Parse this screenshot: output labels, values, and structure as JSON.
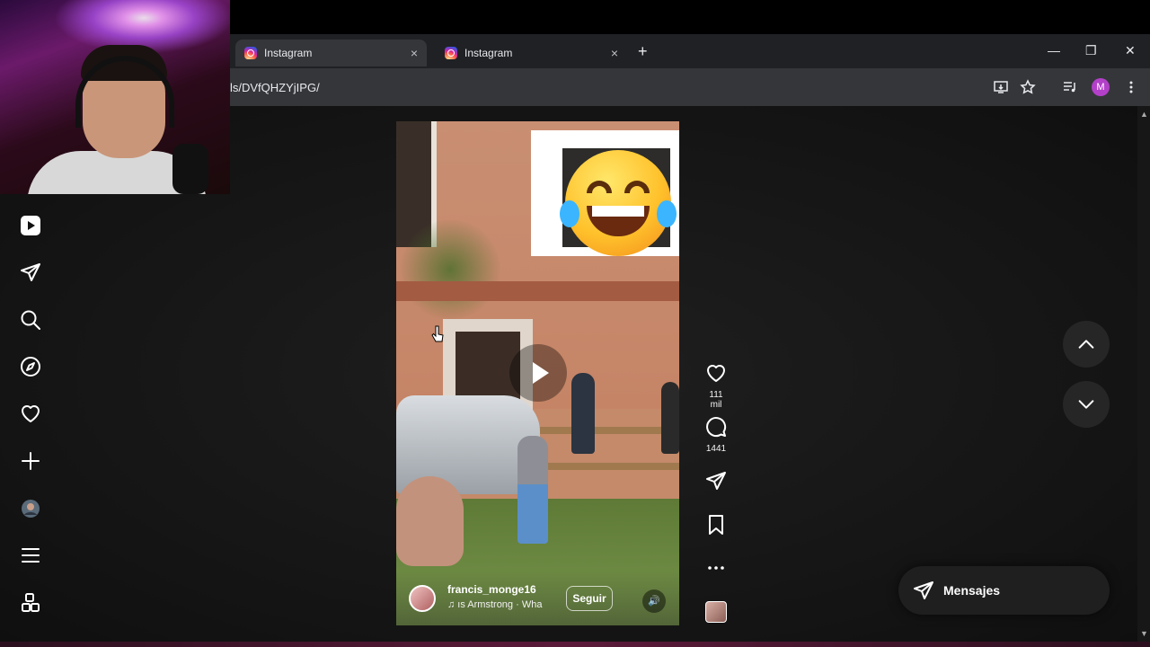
{
  "browser": {
    "tabs": [
      {
        "title": "Instagram",
        "active": true
      },
      {
        "title": "Instagram",
        "active": false
      }
    ],
    "tab_close": "×",
    "new_tab": "+",
    "window_controls": {
      "minimize": "—",
      "restore": "❐",
      "close": "✕"
    },
    "url": "ls/DVfQHZYjIPG/",
    "profile_initial": "M",
    "icons": [
      "install-app-icon",
      "bookmark-star-icon",
      "media-control-icon",
      "kebab-menu-icon"
    ]
  },
  "sidebar": {
    "items": [
      {
        "name": "reels",
        "icon": "reels-icon"
      },
      {
        "name": "messages",
        "icon": "send-icon"
      },
      {
        "name": "search",
        "icon": "search-icon"
      },
      {
        "name": "explore",
        "icon": "compass-icon"
      },
      {
        "name": "notifications",
        "icon": "heart-icon"
      },
      {
        "name": "create",
        "icon": "plus-icon"
      },
      {
        "name": "profile",
        "icon": "avatar"
      },
      {
        "name": "more",
        "icon": "hamburger-icon"
      },
      {
        "name": "also-from-meta",
        "icon": "grid-icon"
      }
    ]
  },
  "reel": {
    "username": "francis_monge16",
    "audio": "♫  ıs Armstrong · Wha",
    "follow_label": "Seguir",
    "mute_icon": "🔊"
  },
  "actions": {
    "likes": "111 mil",
    "comments": "1441"
  },
  "messages_label": "Mensajes",
  "colors": {
    "accent_profile": "#b340c9",
    "page_bg": "#141414",
    "button_bg": "#262626"
  }
}
